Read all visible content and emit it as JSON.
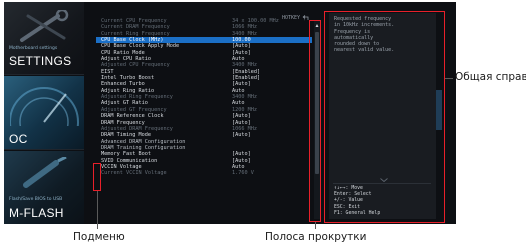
{
  "nav": {
    "settings": {
      "sub": "Motherboard settings",
      "title": "SETTINGS"
    },
    "oc": {
      "title": "OC"
    },
    "mflash": {
      "sub": "Flash/Save BIOS to USB",
      "title": "M-FLASH"
    }
  },
  "hotkey": {
    "label": "HOTKEY",
    "sep": "|"
  },
  "rows": [
    {
      "label": "Current CPU Frequency",
      "value": "34 x 100.00 MHz",
      "state": "ro"
    },
    {
      "label": "Current DRAM Frequency",
      "value": "1066 MHz",
      "state": "ro"
    },
    {
      "label": "Current Ring Frequency",
      "value": "3400 MHz",
      "state": "ro"
    },
    {
      "label": "CPU Base Clock (MHz)",
      "value": "100.00",
      "state": "sel"
    },
    {
      "label": "CPU Base Clock Apply Mode",
      "value": "[Auto]",
      "state": "ed"
    },
    {
      "label": "CPU Ratio Mode",
      "value": "[Auto]",
      "state": "ed"
    },
    {
      "label": "Adjust CPU Ratio",
      "value": "Auto",
      "state": "ed"
    },
    {
      "label": "Adjusted CPU Frequency",
      "value": "3400 MHz",
      "state": "ro"
    },
    {
      "label": "EIST",
      "value": "[Enabled]",
      "state": "ed"
    },
    {
      "label": "Intel Turbo Boost",
      "value": "[Enabled]",
      "state": "ed"
    },
    {
      "label": "Enhanced Turbo",
      "value": "[Auto]",
      "state": "ed"
    },
    {
      "label": "Adjust Ring Ratio",
      "value": "Auto",
      "state": "ed"
    },
    {
      "label": "Adjusted Ring Frequency",
      "value": "3400 MHz",
      "state": "ro"
    },
    {
      "label": "Adjust GT Ratio",
      "value": "Auto",
      "state": "ed"
    },
    {
      "label": "Adjusted GT Frequency",
      "value": "1200 MHz",
      "state": "ro"
    },
    {
      "label": "DRAM Reference Clock",
      "value": "[Auto]",
      "state": "ed"
    },
    {
      "label": "DRAM Frequency",
      "value": "[Auto]",
      "state": "ed"
    },
    {
      "label": "Adjusted DRAM Frequency",
      "value": "1066 MHz",
      "state": "ro"
    },
    {
      "label": "DRAM Timing Mode",
      "value": "[Auto]",
      "state": "ed"
    },
    {
      "label": "Advanced DRAM Configuration",
      "value": "",
      "state": "ro sub"
    },
    {
      "label": "DRAM Training Configuration",
      "value": "",
      "state": "ed sub"
    },
    {
      "label": "Memory Fast Boot",
      "value": "[Auto]",
      "state": "ed"
    },
    {
      "label": "SVID Communication",
      "value": "[Auto]",
      "state": "ed"
    },
    {
      "label": "VCCIN Voltage",
      "value": "Auto",
      "state": "ed"
    },
    {
      "label": "Current VCCIN Voltage",
      "value": "1.760 V",
      "state": "ro"
    }
  ],
  "help": {
    "text": "Requested frequency\nin 10kHz increments.\nFrequency is\nautomatically\nrounded down to\nnearest valid value.",
    "keys": [
      "↑↓←→: Move",
      "Enter: Select",
      "+/-: Value",
      "ESC: Exit",
      "F1: General Help"
    ]
  },
  "annotations": {
    "help": "Общая справка",
    "submenu": "Подменю",
    "scrollbar": "Полоса прокрутки"
  },
  "colors": {
    "highlight": "#e8202a",
    "selected_row": "#1b6fc6"
  }
}
